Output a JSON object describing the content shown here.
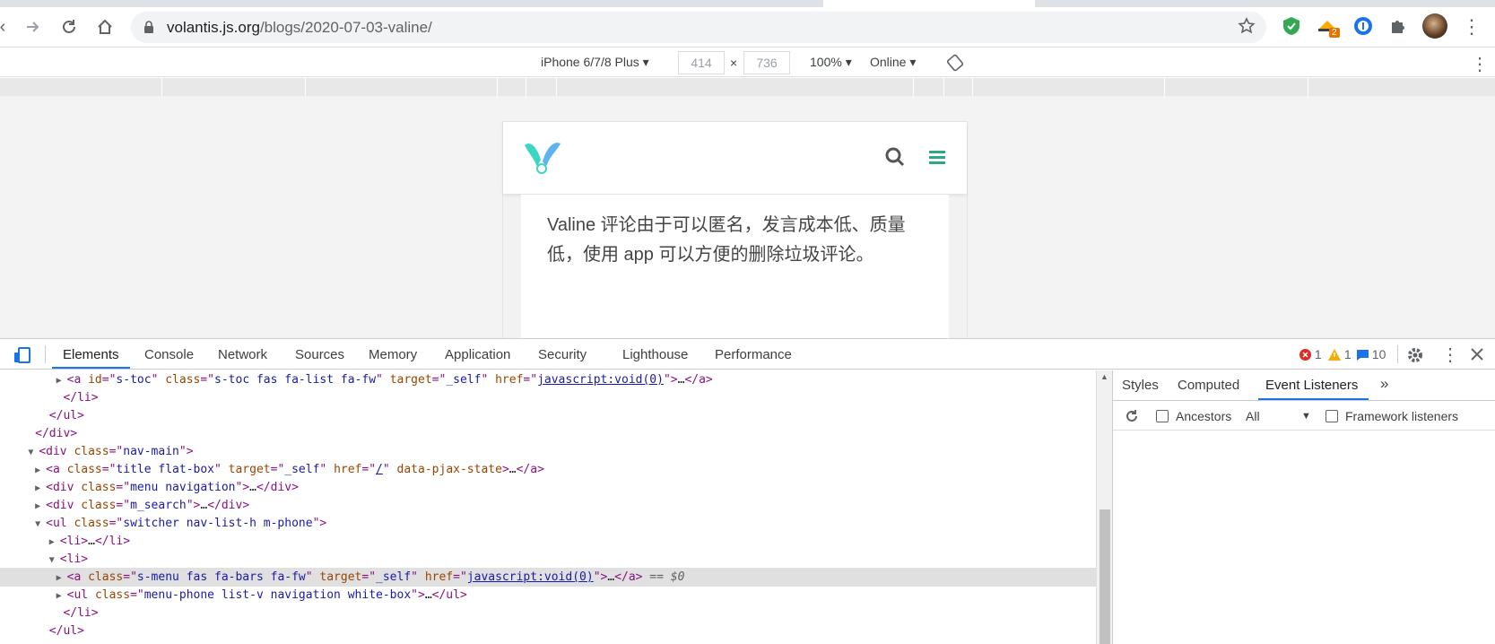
{
  "browser": {
    "url_host": "volantis.js.org",
    "url_path": "/blogs/2020-07-03-valine/",
    "extension_badge": "2"
  },
  "device_toolbar": {
    "device": "iPhone 6/7/8 Plus",
    "width": "414",
    "times": "×",
    "height": "736",
    "zoom": "100%",
    "network": "Online"
  },
  "page": {
    "body_text": "Valine 评论由于可以匿名，发言成本低、质量低，使用 app 可以方便的删除垃圾评论。"
  },
  "devtools": {
    "tabs": [
      "Elements",
      "Console",
      "Network",
      "Sources",
      "Memory",
      "Application",
      "Security",
      "Lighthouse",
      "Performance"
    ],
    "errors": "1",
    "warnings": "1",
    "messages": "10",
    "sidebar_tabs": [
      "Styles",
      "Computed",
      "Event Listeners"
    ],
    "more": "»",
    "ancestors_label": "Ancestors",
    "filter_value": "All",
    "framework_label": "Framework listeners"
  },
  "colors": {
    "accent": "#1a73e8",
    "tag": "#881280",
    "attr_name": "#994500",
    "attr_value": "#1a1aa6",
    "logo_teal": "#3dd6c5",
    "menu_green": "#2aa889"
  }
}
